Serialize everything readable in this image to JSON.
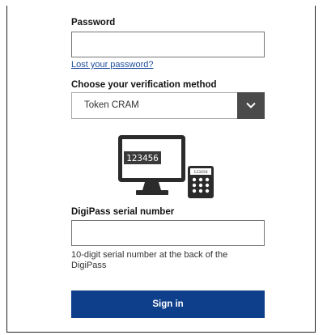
{
  "password": {
    "label": "Password",
    "value": "",
    "lost_link": "Lost your password?"
  },
  "verification": {
    "label": "Choose your verification method",
    "selected": "Token CRAM"
  },
  "illustration": {
    "monitor_code": "123456",
    "token_code": "123456"
  },
  "serial": {
    "label": "DigiPass serial number",
    "value": "",
    "hint": "10-digit serial number at the back of the DigiPass"
  },
  "signin": {
    "label": "Sign in"
  },
  "colors": {
    "primary": "#0e3f8b",
    "link": "#1f4e9c",
    "select_button": "#4a4a4a"
  },
  "icons": {
    "dropdown": "chevron-down-icon",
    "monitor": "monitor-icon",
    "token": "digipass-token-icon"
  }
}
